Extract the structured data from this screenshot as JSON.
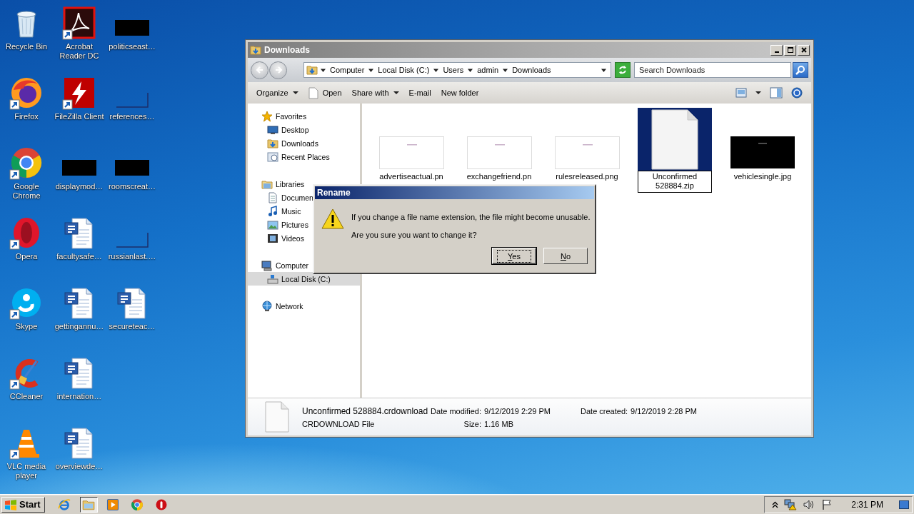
{
  "desktop": {
    "icons": [
      {
        "label": "Recycle Bin",
        "kind": "recycle-bin",
        "shortcut": false
      },
      {
        "label": "Firefox",
        "kind": "firefox",
        "shortcut": true
      },
      {
        "label": "Google Chrome",
        "kind": "chrome",
        "shortcut": true
      },
      {
        "label": "Opera",
        "kind": "opera",
        "shortcut": true
      },
      {
        "label": "Skype",
        "kind": "skype",
        "shortcut": true
      },
      {
        "label": "CCleaner",
        "kind": "ccleaner",
        "shortcut": true
      },
      {
        "label": "VLC media player",
        "kind": "vlc",
        "shortcut": true
      },
      {
        "label": "Acrobat Reader DC",
        "kind": "acrobat",
        "shortcut": true
      },
      {
        "label": "FileZilla Client",
        "kind": "filezilla",
        "shortcut": true
      },
      {
        "label": "displaymod…",
        "kind": "dark-thumbnail",
        "shortcut": false
      },
      {
        "label": "facultysafe…",
        "kind": "word-document",
        "shortcut": false
      },
      {
        "label": "gettingannu…",
        "kind": "word-document",
        "shortcut": false
      },
      {
        "label": "internation…",
        "kind": "word-document",
        "shortcut": false
      },
      {
        "label": "overviewde…",
        "kind": "word-document",
        "shortcut": false
      },
      {
        "label": "politicseast…",
        "kind": "dark-thumbnail",
        "shortcut": false
      },
      {
        "label": "references…",
        "kind": "blank-thumbnail",
        "shortcut": false
      },
      {
        "label": "roomscreat…",
        "kind": "dark-thumbnail",
        "shortcut": false
      },
      {
        "label": "russianlast.…",
        "kind": "blank-thumbnail",
        "shortcut": false
      },
      {
        "label": "secureteac…",
        "kind": "word-document",
        "shortcut": false
      }
    ]
  },
  "explorer": {
    "title": "Downloads",
    "breadcrumb": [
      "Computer",
      "Local Disk (C:)",
      "Users",
      "admin",
      "Downloads"
    ],
    "search": {
      "placeholder": "Search Downloads"
    },
    "toolbar": [
      {
        "label": "Organize",
        "kind": "menu"
      },
      {
        "label": "Open",
        "kind": "open"
      },
      {
        "label": "Share with",
        "kind": "menu"
      },
      {
        "label": "E-mail",
        "kind": "plain"
      },
      {
        "label": "New folder",
        "kind": "plain"
      }
    ],
    "nav": [
      {
        "label": "Favorites",
        "kind": "favorites",
        "selected": false,
        "children": [
          {
            "label": "Desktop",
            "kind": "desktop",
            "selected": false
          },
          {
            "label": "Downloads",
            "kind": "downloads",
            "selected": false
          },
          {
            "label": "Recent Places",
            "kind": "recent",
            "selected": false
          }
        ]
      },
      {
        "label": "Libraries",
        "kind": "libraries",
        "selected": false,
        "children": [
          {
            "label": "Documen",
            "kind": "documents",
            "selected": false
          },
          {
            "label": "Music",
            "kind": "music",
            "selected": false
          },
          {
            "label": "Pictures",
            "kind": "pictures",
            "selected": false
          },
          {
            "label": "Videos",
            "kind": "videos",
            "selected": false
          }
        ]
      },
      {
        "label": "Computer",
        "kind": "computer",
        "selected": false,
        "children": [
          {
            "label": "Local Disk (C:)",
            "kind": "disk",
            "selected": true
          }
        ]
      },
      {
        "label": "Network",
        "kind": "network",
        "selected": false
      }
    ],
    "files": [
      {
        "name": "advertiseactual.pn",
        "kind": "white-thumbnail",
        "selected": false
      },
      {
        "name": "exchangefriend.pn",
        "kind": "white-thumbnail",
        "selected": false
      },
      {
        "name": "rulesreleased.png",
        "kind": "white-thumbnail",
        "selected": false
      },
      {
        "name": "Unconfirmed 528884.zip",
        "kind": "document",
        "selected": true
      },
      {
        "name": "vehiclesingle.jpg",
        "kind": "black-thumbnail",
        "selected": false
      }
    ],
    "details": {
      "name": "Unconfirmed 528884.crdownload",
      "type": "CRDOWNLOAD File",
      "fields": [
        {
          "label": "Date modified:",
          "value": "9/12/2019 2:29 PM"
        },
        {
          "label": "Size:",
          "value": "1.16 MB"
        },
        {
          "label": "Date created:",
          "value": "9/12/2019 2:28 PM"
        }
      ]
    }
  },
  "dialog": {
    "title": "Rename",
    "message": "If you change a file name extension, the file might become unusable.",
    "question": "Are you sure you want to change it?",
    "buttons": [
      {
        "label": "Yes",
        "default": true
      },
      {
        "label": "No",
        "default": false
      }
    ]
  },
  "taskbar": {
    "start": "Start",
    "apps": [
      {
        "kind": "ie",
        "active": false
      },
      {
        "kind": "explorer",
        "active": true
      },
      {
        "kind": "media-player",
        "active": false
      },
      {
        "kind": "chrome",
        "active": false
      },
      {
        "kind": "opera",
        "active": false
      }
    ],
    "time": "2:31 PM"
  }
}
